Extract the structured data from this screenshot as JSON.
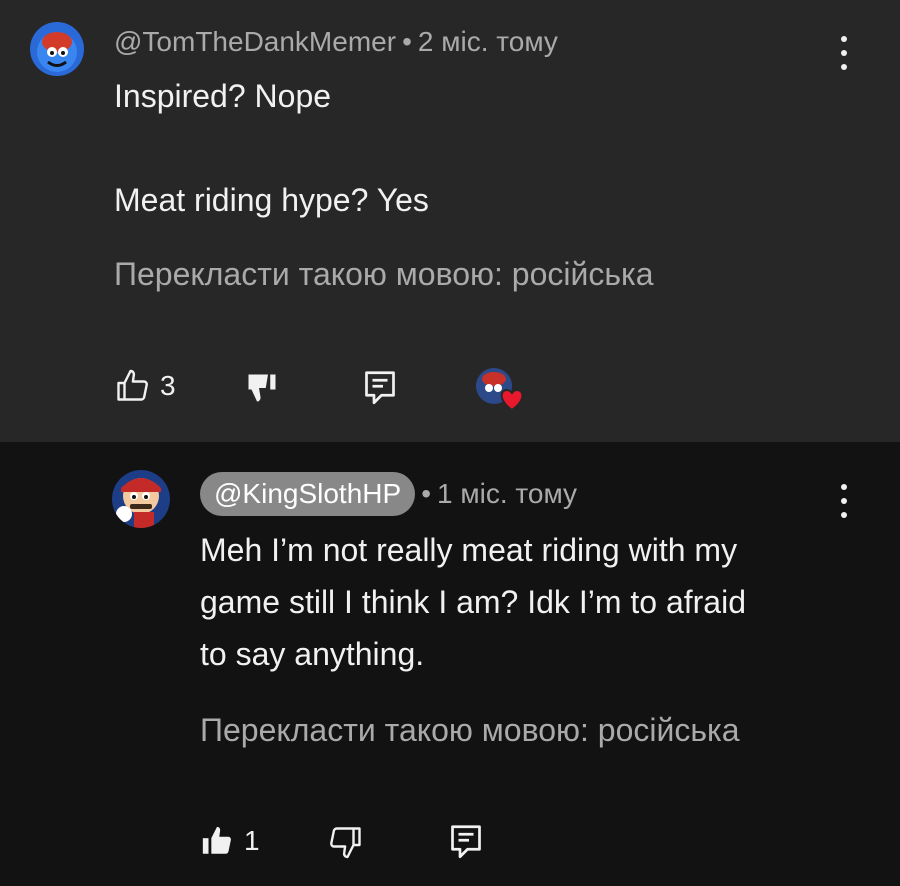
{
  "comment": {
    "author": "@TomTheDankMemer",
    "time": "2 міс. тому",
    "lines": [
      "Inspired? Nope",
      "Meat riding hype? Yes"
    ],
    "translate": "Перекласти такою мовою: російська",
    "like_count": "3",
    "avatar_icon": "avatar-tom",
    "heart_icon": "creator-heart-icon"
  },
  "reply": {
    "author": "@KingSlothHP",
    "time": "1 міс. тому",
    "lines": [
      "Meh I’m not really meat riding with my",
      "game still I think I am? Idk I’m to afraid",
      "to say anything."
    ],
    "translate": "Перекласти такою мовою: російська",
    "like_count": "1",
    "avatar_icon": "avatar-kingsloth"
  },
  "colors": {
    "top_bg": "#272727",
    "reply_bg": "#121212",
    "text": "#f1f1f1",
    "muted": "#aaaaaa",
    "pill": "#888888",
    "heart": "#e8192c"
  }
}
